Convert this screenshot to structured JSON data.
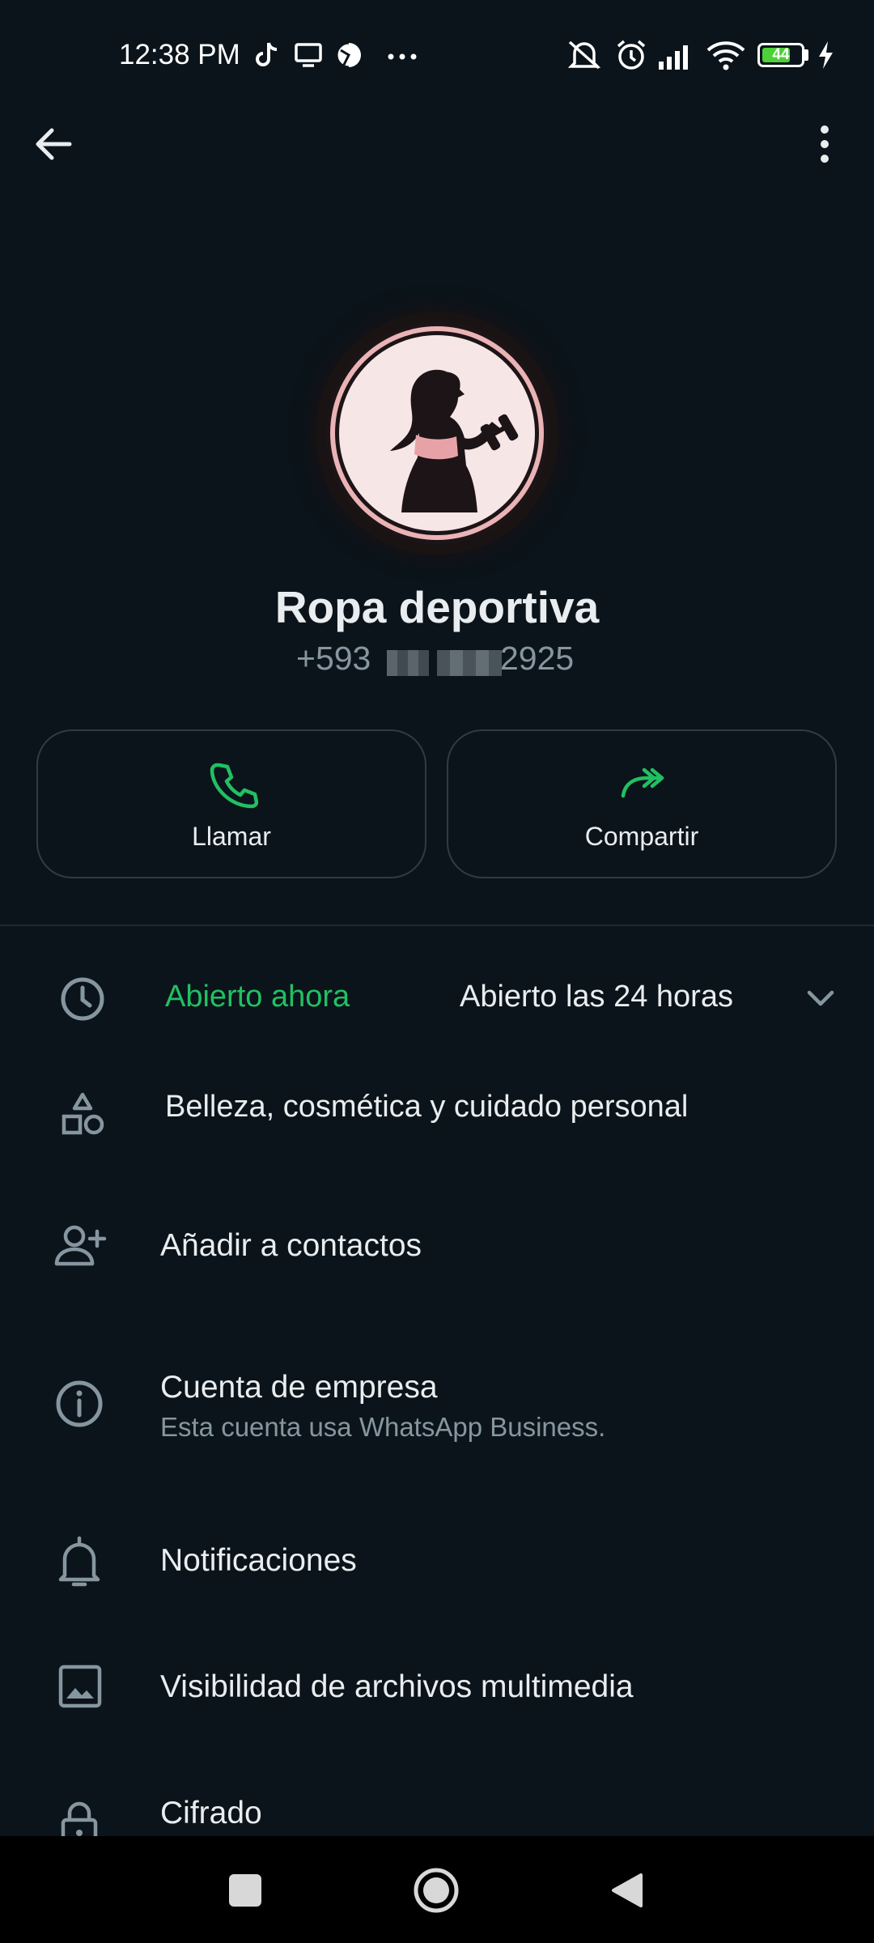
{
  "status_bar": {
    "time": "12:38 PM",
    "battery_level": "44",
    "left_icons": [
      "tiktok-icon",
      "tv-icon",
      "browser-icon",
      "more-dots-icon"
    ],
    "right_icons": [
      "mute-icon",
      "alarm-icon",
      "signal-icon",
      "wifi-icon",
      "battery-icon",
      "charging-icon"
    ]
  },
  "toolbar": {
    "back_icon": "arrow-back-icon",
    "menu_icon": "more-vert-icon"
  },
  "profile": {
    "name": "Ropa deportiva",
    "phone_prefix": "+593",
    "phone_suffix": "2925"
  },
  "actions": [
    {
      "label": "Llamar",
      "icon": "phone-icon"
    },
    {
      "label": "Compartir",
      "icon": "share-icon"
    }
  ],
  "hours": {
    "status": "Abierto ahora",
    "detail": "Abierto las 24 horas"
  },
  "rows": {
    "category": "Belleza, cosmética y cuidado personal",
    "add_contact": "Añadir a contactos",
    "business_title": "Cuenta de empresa",
    "business_sub": "Esta cuenta usa WhatsApp Business.",
    "notifications": "Notificaciones",
    "media_visibility": "Visibilidad de archivos multimedia",
    "encryption": "Cifrado"
  },
  "colors": {
    "background": "#0b141a",
    "accent_green": "#21c063",
    "secondary_text": "#8696a0"
  }
}
